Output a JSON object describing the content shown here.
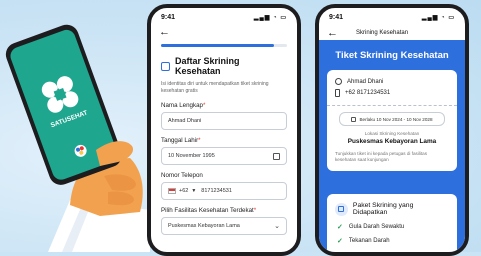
{
  "left_phone": {
    "brand_label": "SATUSEHAT"
  },
  "form_screen": {
    "time": "9:41",
    "progress_fraction": 0.9,
    "title": "Daftar Skrining Kesehatan",
    "description": "Isi identitas diri untuk mendapatkan tiket skrining kesehatan gratis",
    "fields": [
      {
        "label": "Nama Lengkap",
        "required": "*",
        "value": "Ahmad Dhani"
      },
      {
        "label": "Tanggal Lahir",
        "required": "*",
        "value": "10 November 1995"
      },
      {
        "label": "Nomor Telepon",
        "required": "",
        "prefix": "+62",
        "value": "8171234531"
      },
      {
        "label": "Pilih Fasilitas Kesehatan Terdekat",
        "required": "*",
        "value": "Puskesmas Kebayoran Lama"
      }
    ]
  },
  "ticket_screen": {
    "time": "9:41",
    "header_title": "Skrining Kesehatan",
    "ticket_title": "Tiket Skrining Kesehatan",
    "name": "Ahmad Dhani",
    "phone": "+62 8171234531",
    "date_range": "Berlaku 10 Nov 2024 - 10 Nov 2028",
    "location_label": "Lokasi Skrining Kesehatan",
    "location_value": "Puskesmas Kebayoran Lama",
    "note": "Tunjukkan tiket ini kepada petugas di fasilitas kesehatan saat kunjungan",
    "package_title": "Paket Skrining yang Didapatkan",
    "package_items": [
      "Gula Darah Sewaktu",
      "Tekanan Darah"
    ]
  },
  "colors": {
    "primary": "#2e6fde",
    "background": "#cbe4f5",
    "phone_green": "#1fa68f",
    "check": "#2e9c5a"
  }
}
